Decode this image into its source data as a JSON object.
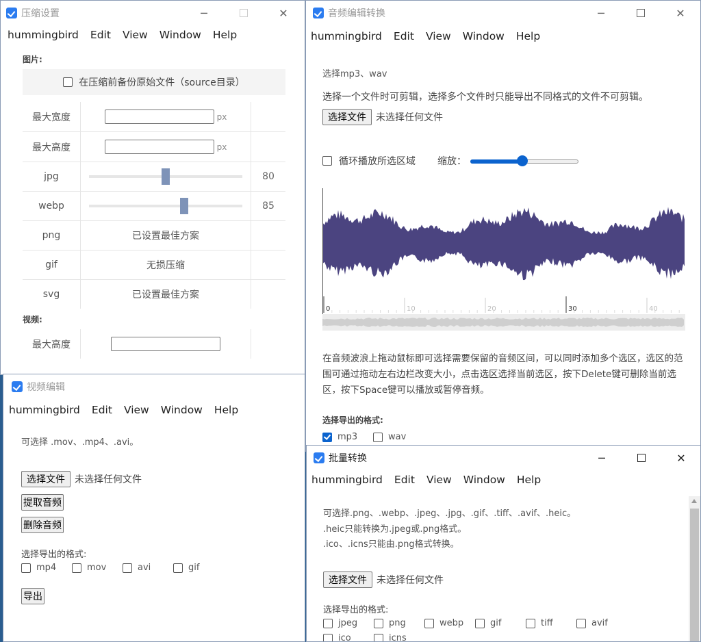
{
  "compress": {
    "title": "压缩设置",
    "image_section": "图片:",
    "backup_label": "在压缩前备份原始文件（source目录）",
    "rows": [
      {
        "label": "最大宽度",
        "unit": "px"
      },
      {
        "label": "最大高度",
        "unit": "px"
      },
      {
        "label": "jpg",
        "value": "80",
        "level": 0.5
      },
      {
        "label": "webp",
        "value": "85",
        "level": 0.62
      },
      {
        "label": "png",
        "text": "已设置最佳方案"
      },
      {
        "label": "gif",
        "text": "无损压缩"
      },
      {
        "label": "svg",
        "text": "已设置最佳方案"
      }
    ],
    "video_section": "视频:",
    "video_row": {
      "label": "最大高度"
    }
  },
  "menu": [
    "hummingbird",
    "Edit",
    "View",
    "Window",
    "Help"
  ],
  "audio": {
    "title": "音频编辑转换",
    "hint1": "选择mp3、wav",
    "hint2": "选择一个文件时可剪辑，选择多个文件时只能导出不同格式的文件不可剪辑。",
    "choose_button": "选择文件",
    "no_file": "未选择任何文件",
    "loop_label": "循环播放所选区域",
    "zoom_label": "缩放：",
    "zoom_level": 0.48,
    "timeline_ticks": [
      "0",
      "10",
      "20",
      "30",
      "40"
    ],
    "description": "在音频波浪上拖动鼠标即可选择需要保留的音频区间，可以同时添加多个选区，选区的范围可通过拖动左右边栏改变大小，点击选区选择当前选区，按下Delete键可删除当前选区，按下Space键可以播放或暂停音频。",
    "export_label": "选择导出的格式:",
    "formats": [
      {
        "label": "mp3",
        "checked": true
      },
      {
        "label": "wav",
        "checked": false
      }
    ],
    "wave_color": "#4b4480"
  },
  "video": {
    "title": "视频编辑",
    "hint": "可选择 .mov、.mp4、.avi。",
    "choose_button": "选择文件",
    "no_file": "未选择任何文件",
    "extract_button": "提取音频",
    "delete_button": "删除音频",
    "export_label": "选择导出的格式:",
    "formats": [
      "mp4",
      "mov",
      "avi",
      "gif"
    ],
    "export_button": "导出"
  },
  "batch": {
    "title": "批量转换",
    "hint1": "可选择.png、.webp、.jpeg、.jpg、.gif、.tiff、.avif、.heic。",
    "hint2": ".heic只能转换为.jpeg或.png格式。",
    "hint3": ".ico、.icns只能由.png格式转换。",
    "choose_button": "选择文件",
    "no_file": "未选择任何文件",
    "export_label": "选择导出的格式:",
    "formats": [
      "jpeg",
      "png",
      "webp",
      "gif",
      "tiff",
      "avif",
      "ico",
      "icns"
    ]
  },
  "colors": {
    "accent": "#2b7cf0",
    "desktop": "#2a5d8f"
  }
}
